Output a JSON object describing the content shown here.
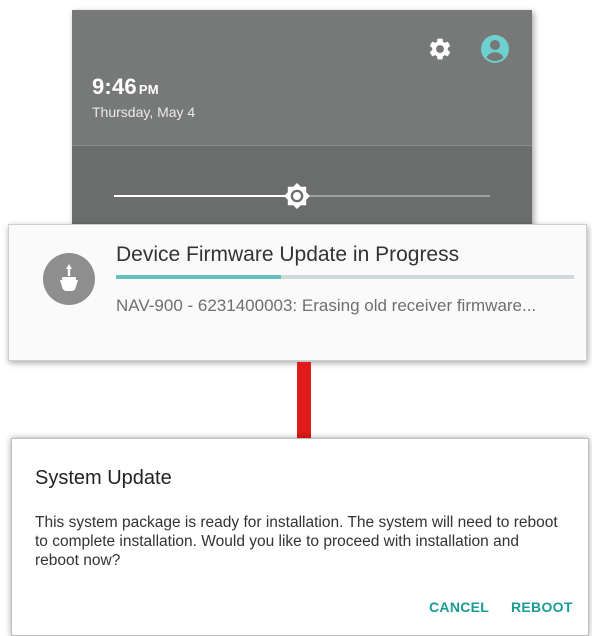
{
  "shade": {
    "time": "9:46",
    "ampm": "PM",
    "date": "Thursday, May 4",
    "icons": {
      "settings": "gear-icon",
      "user": "user-account-icon",
      "brightness": "brightness-icon"
    },
    "brightness_level": 0.49
  },
  "notification": {
    "icon": "firmware-update-icon",
    "title": "Device Firmware Update in Progress",
    "progress": 0.36,
    "message": "NAV-900 - 6231400003: Erasing old receiver firmware..."
  },
  "dialog": {
    "title": "System Update",
    "message": "This system package is ready for installation. The system will need to reboot to complete installation. Would you like to proceed with installation and reboot now?",
    "cancel_label": "CANCEL",
    "reboot_label": "REBOOT"
  },
  "colors": {
    "accent": "#1a9b94",
    "progress": "#64c1c0",
    "arrow": "#e01b1b",
    "user_icon": "#6fd0d0"
  }
}
